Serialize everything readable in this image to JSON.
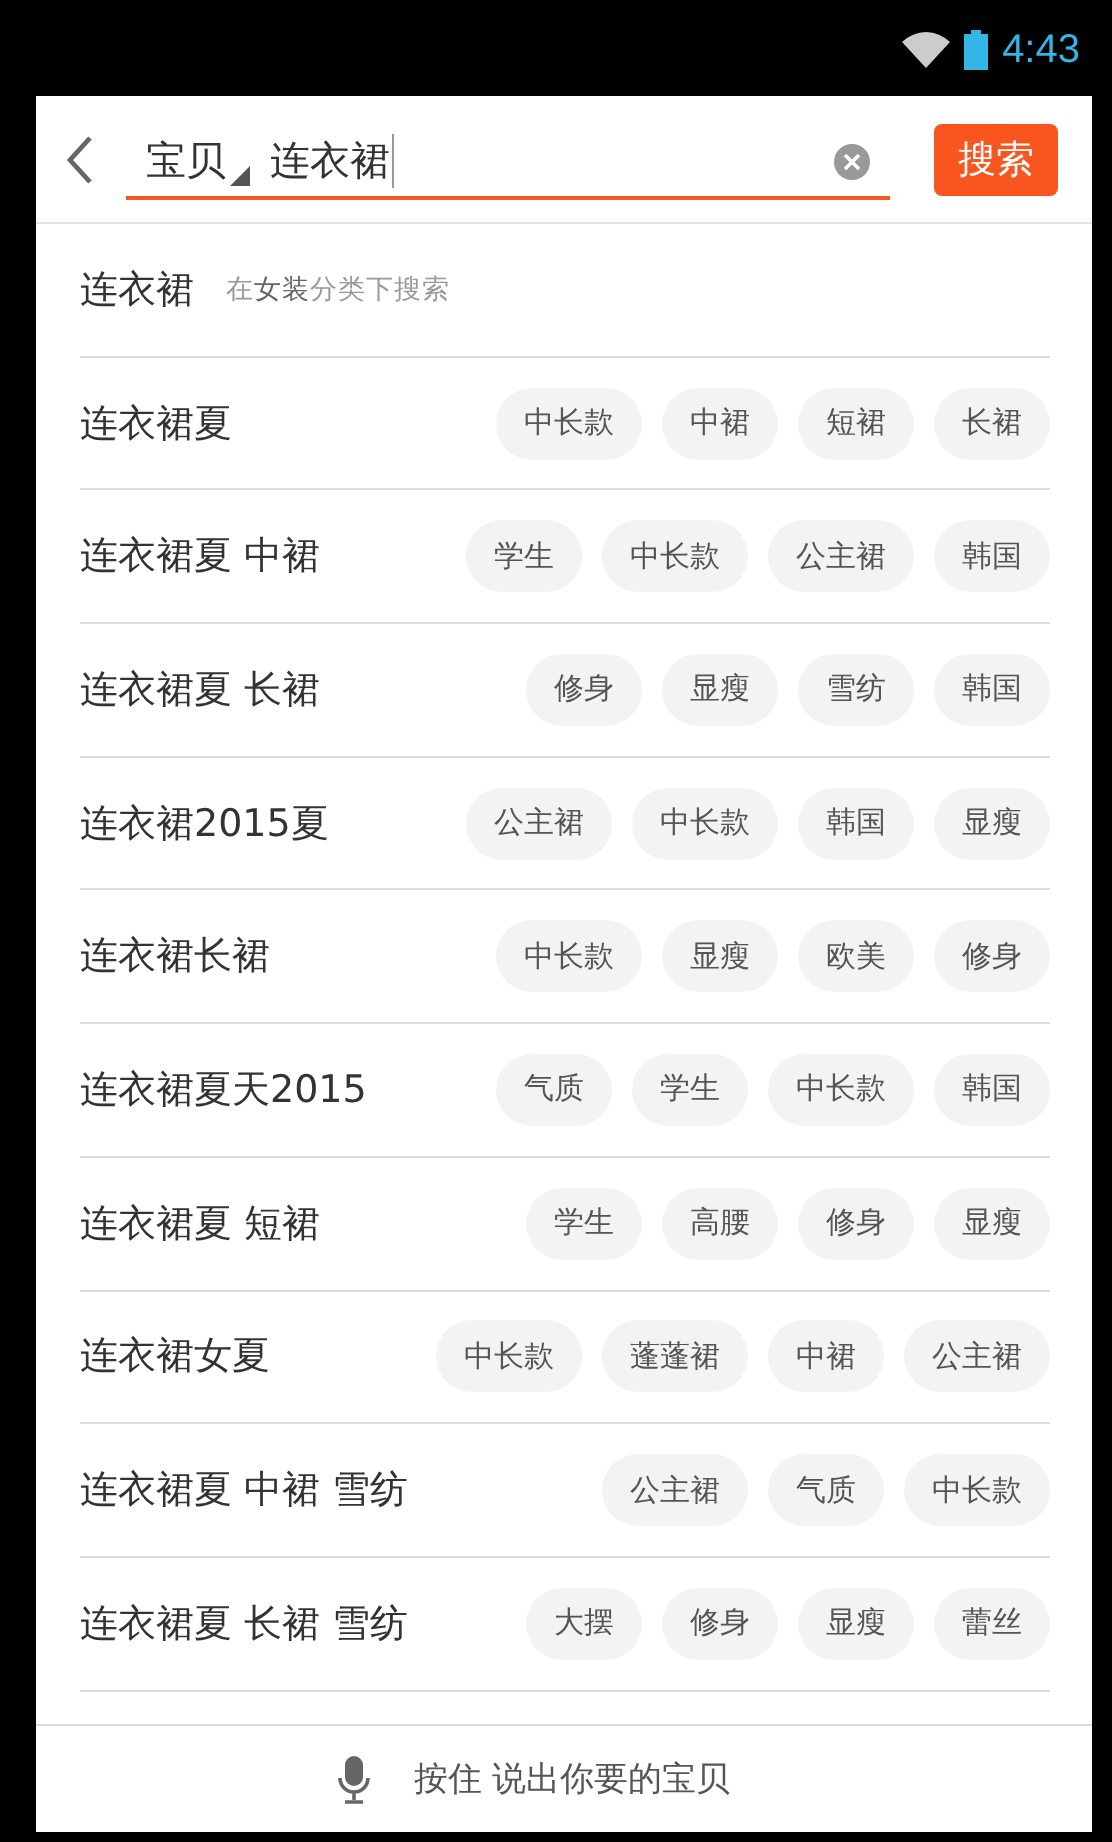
{
  "status_bar": {
    "time": "4:43"
  },
  "search_bar": {
    "scope": "宝贝",
    "query": "连衣裙",
    "button": "搜索"
  },
  "category_suggestion": {
    "text": "连衣裙",
    "hint": "在**女装**分类下搜索"
  },
  "suggestions": [
    {
      "text": "连衣裙夏",
      "tags": [
        "中长款",
        "中裙",
        "短裙",
        "长裙"
      ]
    },
    {
      "text": "连衣裙夏 中裙",
      "tags": [
        "学生",
        "中长款",
        "公主裙",
        "韩国"
      ]
    },
    {
      "text": "连衣裙夏 长裙",
      "tags": [
        "修身",
        "显瘦",
        "雪纺",
        "韩国"
      ]
    },
    {
      "text": "连衣裙2015夏",
      "tags": [
        "公主裙",
        "中长款",
        "韩国",
        "显瘦"
      ]
    },
    {
      "text": "连衣裙长裙",
      "tags": [
        "中长款",
        "显瘦",
        "欧美",
        "修身"
      ]
    },
    {
      "text": "连衣裙夏天2015",
      "tags": [
        "气质",
        "学生",
        "中长款",
        "韩国"
      ]
    },
    {
      "text": "连衣裙夏 短裙",
      "tags": [
        "学生",
        "高腰",
        "修身",
        "显瘦"
      ]
    },
    {
      "text": "连衣裙女夏",
      "tags": [
        "中长款",
        "蓬蓬裙",
        "中裙",
        "公主裙"
      ]
    },
    {
      "text": "连衣裙夏 中裙 雪纺",
      "tags": [
        "公主裙",
        "气质",
        "中长款"
      ]
    },
    {
      "text": "连衣裙夏 长裙 雪纺",
      "tags": [
        "大摆",
        "修身",
        "显瘦",
        "蕾丝"
      ]
    }
  ],
  "voice_bar": {
    "label": "按住 说出你要的宝贝"
  }
}
